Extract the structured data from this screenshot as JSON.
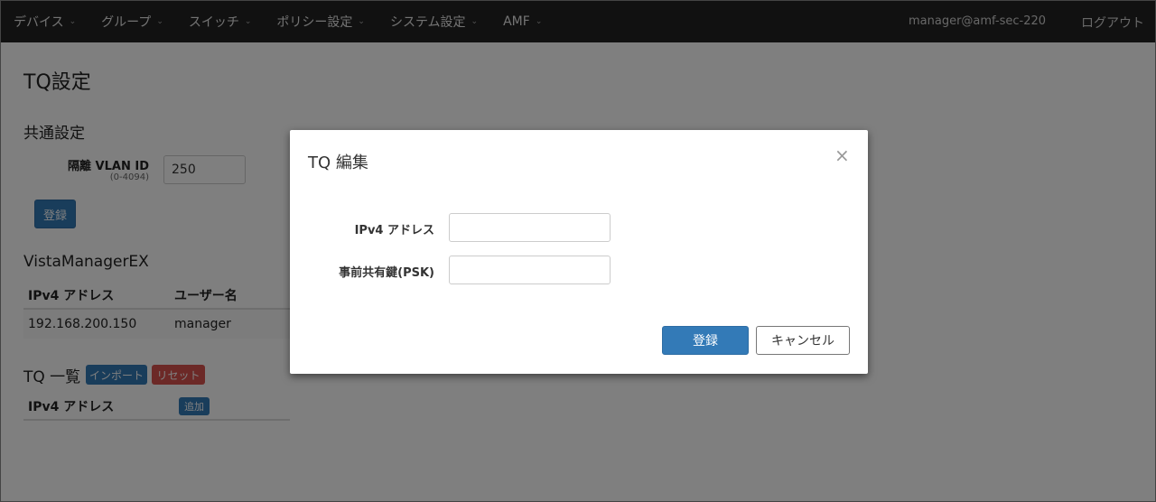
{
  "navbar": {
    "items": [
      {
        "label": "デバイス"
      },
      {
        "label": "グループ"
      },
      {
        "label": "スイッチ"
      },
      {
        "label": "ポリシー設定"
      },
      {
        "label": "システム設定"
      },
      {
        "label": "AMF"
      }
    ],
    "user": "manager@amf-sec-220",
    "logout": "ログアウト"
  },
  "page": {
    "title": "TQ設定",
    "common": {
      "heading": "共通設定",
      "vlan_label": "隔離 VLAN ID",
      "vlan_range": "(0-4094)",
      "vlan_value": "250",
      "register_label": "登録"
    },
    "vista": {
      "heading": "VistaManagerEX",
      "columns": [
        "IPv4 アドレス",
        "ユーザー名"
      ],
      "rows": [
        [
          "192.168.200.150",
          "manager"
        ]
      ]
    },
    "tq": {
      "heading": "TQ 一覧",
      "import_label": "インポート",
      "reset_label": "リセット",
      "column": "IPv4 アドレス",
      "add_label": "追加"
    }
  },
  "modal": {
    "title": "TQ 編集",
    "close": "×",
    "ipv4_label": "IPv4 アドレス",
    "ipv4_value": "",
    "psk_label": "事前共有鍵(PSK)",
    "psk_value": "",
    "register_label": "登録",
    "cancel_label": "キャンセル"
  }
}
